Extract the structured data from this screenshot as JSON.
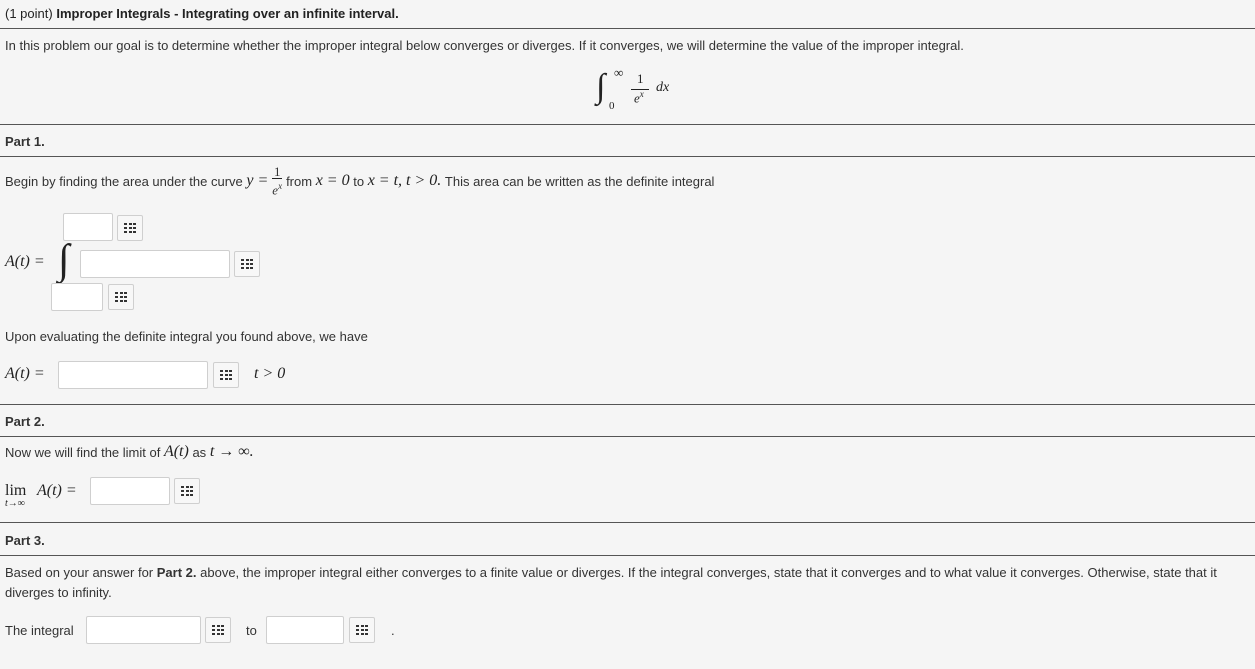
{
  "header": {
    "points": "(1 point)",
    "title": "Improper Integrals - Integrating over an infinite interval."
  },
  "intro": "In this problem our goal is to determine whether the improper integral below converges or diverges. If it converges, we will determine the value of the improper integral.",
  "main_integral": {
    "upper": "∞",
    "lower": "0",
    "numerator": "1",
    "den_base": "e",
    "den_exp": "x",
    "dx": "dx"
  },
  "part1": {
    "heading": "Part 1.",
    "sentence_a": "Begin by finding the area under the curve",
    "y_eq": "y =",
    "frac_num": "1",
    "frac_den_base": "e",
    "frac_den_exp": "x",
    "from": "from",
    "x_eq_0": "x = 0",
    "to": "to",
    "x_eq_t": "x = t, t > 0.",
    "sentence_b": "This area can be written as the definite integral",
    "A_label": "A(t) =",
    "integral_sign": "∫",
    "upper_limit_value": "",
    "integrand_value": "",
    "lower_limit_value": "",
    "evaluating_text": "Upon evaluating the definite integral you found above, we have",
    "A_label2": "A(t) =",
    "A_value": "",
    "t_cond": "t > 0"
  },
  "part2": {
    "heading": "Part 2.",
    "sentence": "Now we will find the limit of",
    "A_t": "A(t)",
    "as": "as",
    "t_to_inf": "t → ∞.",
    "lim": "lim",
    "lim_sub": "t→∞",
    "lim_A": "A(t) =",
    "limit_value": ""
  },
  "part3": {
    "heading": "Part 3.",
    "sentence_pre": "Based on your answer for",
    "sentence_bold": "Part 2.",
    "sentence_post": "above, the improper integral either converges to a finite value or diverges. If the integral converges, state that it converges and to what value it converges. Otherwise, state that it diverges to infinity.",
    "the_integral": "The integral",
    "verb_value": "",
    "to": "to",
    "target_value": "",
    "period": "."
  },
  "icons": {
    "palette": "equation-palette-icon"
  }
}
